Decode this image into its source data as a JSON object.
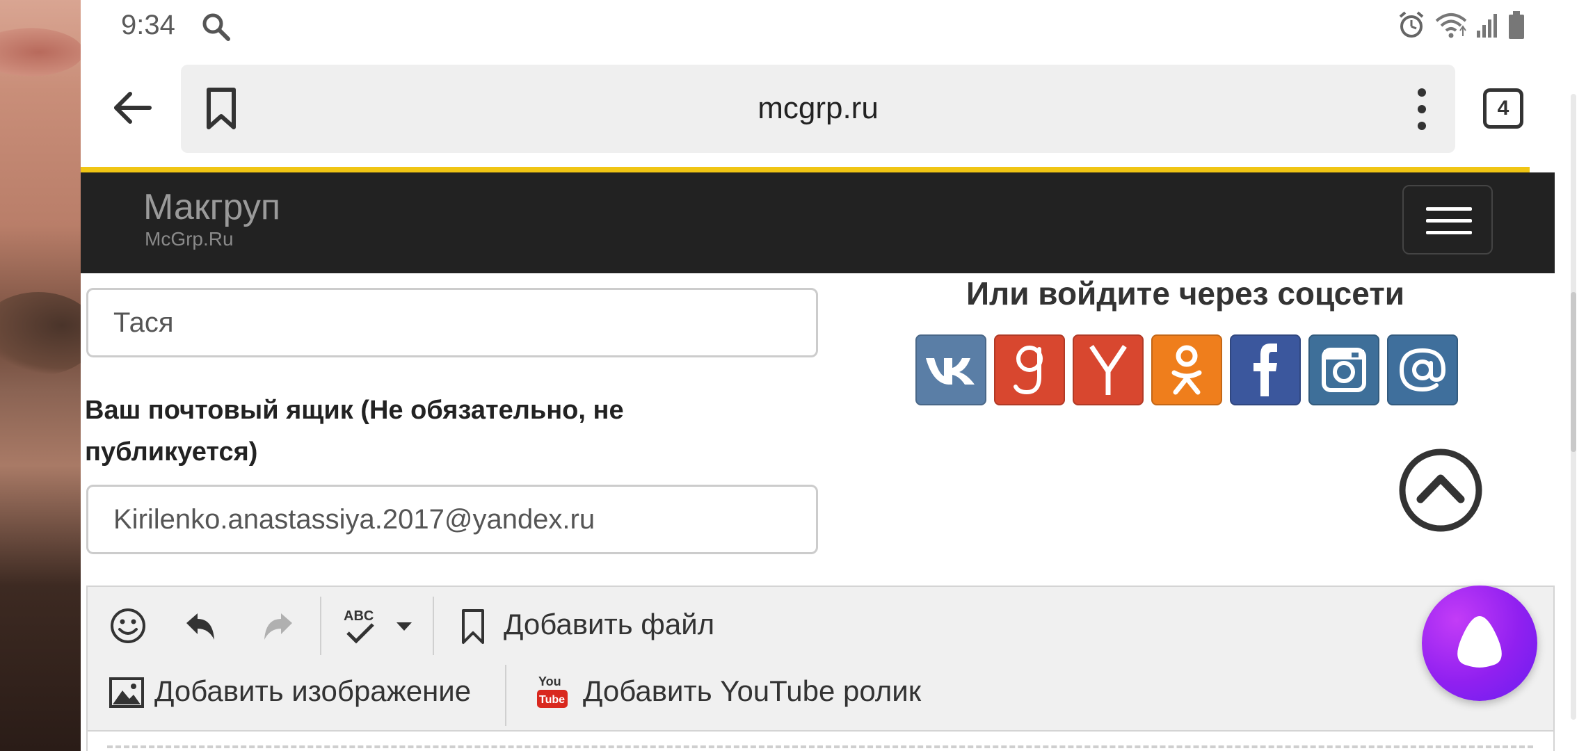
{
  "status_bar": {
    "time": "9:34"
  },
  "browser": {
    "url": "mcgrp.ru",
    "tab_count": "4"
  },
  "site": {
    "brand": "Макгруп",
    "subtitle": "McGrp.Ru"
  },
  "form": {
    "name_value": "Тася",
    "email_label": "Ваш почтовый ящик (Не обязательно, не публикуется)",
    "email_value": "Kirilenko.anastassiya.2017@yandex.ru"
  },
  "social": {
    "title": "Или войдите через соцсети",
    "networks": [
      "vk",
      "google",
      "yandex",
      "odnoklassniki",
      "facebook",
      "instagram",
      "mail"
    ],
    "colors": {
      "vk": "#5a7ea6",
      "google": "#d8472f",
      "yandex": "#d8472f",
      "odnoklassniki": "#ef7e1c",
      "facebook": "#3b579d",
      "instagram": "#3e6f99",
      "mail": "#3f6f9c"
    }
  },
  "toolbar": {
    "add_file": "Добавить файл",
    "add_image": "Добавить изображение",
    "add_youtube": "Добавить YouTube ролик",
    "youtube_logo": {
      "top": "You",
      "bottom": "Tube"
    },
    "spellcheck_glyph": "ABC"
  }
}
